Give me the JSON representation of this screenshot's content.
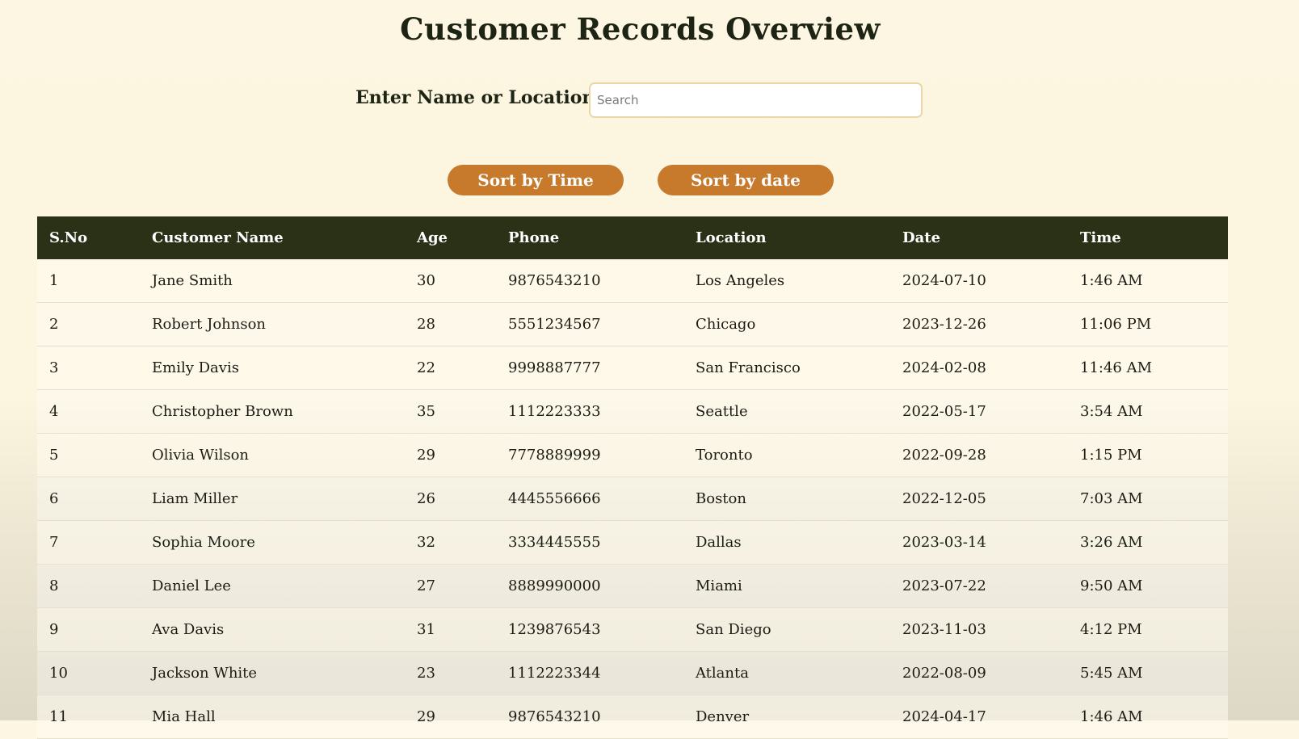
{
  "page": {
    "title": "Customer Records Overview"
  },
  "search": {
    "label": "Enter Name or Location",
    "placeholder": "Search",
    "value": ""
  },
  "buttons": {
    "sort_time": "Sort by Time",
    "sort_date": "Sort by date"
  },
  "colors": {
    "header_bg": "#2a3117",
    "button_bg": "#c77a2c",
    "page_bg": "#fcf6e2"
  },
  "table": {
    "columns": [
      "S.No",
      "Customer Name",
      "Age",
      "Phone",
      "Location",
      "Date",
      "Time"
    ],
    "rows": [
      [
        "1",
        "Jane Smith",
        "30",
        "9876543210",
        "Los Angeles",
        "2024-07-10",
        "1:46 AM"
      ],
      [
        "2",
        "Robert Johnson",
        "28",
        "5551234567",
        "Chicago",
        "2023-12-26",
        "11:06 PM"
      ],
      [
        "3",
        "Emily Davis",
        "22",
        "9998887777",
        "San Francisco",
        "2024-02-08",
        "11:46 AM"
      ],
      [
        "4",
        "Christopher Brown",
        "35",
        "1112223333",
        "Seattle",
        "2022-05-17",
        "3:54 AM"
      ],
      [
        "5",
        "Olivia Wilson",
        "29",
        "7778889999",
        "Toronto",
        "2022-09-28",
        "1:15 PM"
      ],
      [
        "6",
        "Liam Miller",
        "26",
        "4445556666",
        "Boston",
        "2022-12-05",
        "7:03 AM"
      ],
      [
        "7",
        "Sophia Moore",
        "32",
        "3334445555",
        "Dallas",
        "2023-03-14",
        "3:26 AM"
      ],
      [
        "8",
        "Daniel Lee",
        "27",
        "8889990000",
        "Miami",
        "2023-07-22",
        "9:50 AM"
      ],
      [
        "9",
        "Ava Davis",
        "31",
        "1239876543",
        "San Diego",
        "2023-11-03",
        "4:12 PM"
      ],
      [
        "10",
        "Jackson White",
        "23",
        "1112223344",
        "Atlanta",
        "2022-08-09",
        "5:45 AM"
      ],
      [
        "11",
        "Mia Hall",
        "29",
        "9876543210",
        "Denver",
        "2024-04-17",
        "1:46 AM"
      ]
    ]
  }
}
